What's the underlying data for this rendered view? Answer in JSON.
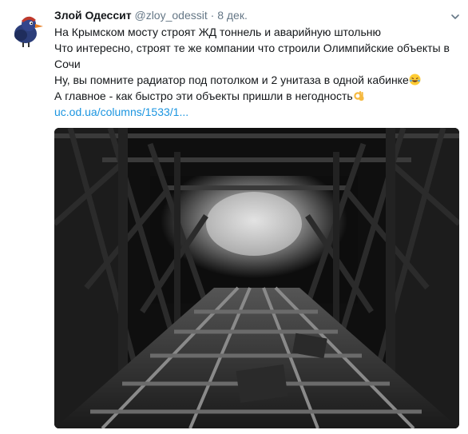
{
  "tweet": {
    "display_name": "Злой Одессит",
    "handle": "@zloy_odessit",
    "separator": "·",
    "time": "8 дек.",
    "lines": [
      "На Крымском мосту строят ЖД тоннель и аварийную штольню",
      "Что интересно, строят те же компании что строили Олимпийские объекты в Сочи",
      "Ну, вы помните радиатор под потолком и 2 унитаза в одной кабинке",
      "А главное - как быстро эти объекты пришли в негодность"
    ],
    "link": "uc.od.ua/columns/1533/1...",
    "emoji_laugh": "rolling-on-floor-laughing-emoji",
    "emoji_ok": "ok-hand-emoji"
  },
  "icons": {
    "menu": "chevron-down-icon"
  },
  "colors": {
    "name": "#14171a",
    "meta": "#657786",
    "link": "#1b95e0"
  }
}
